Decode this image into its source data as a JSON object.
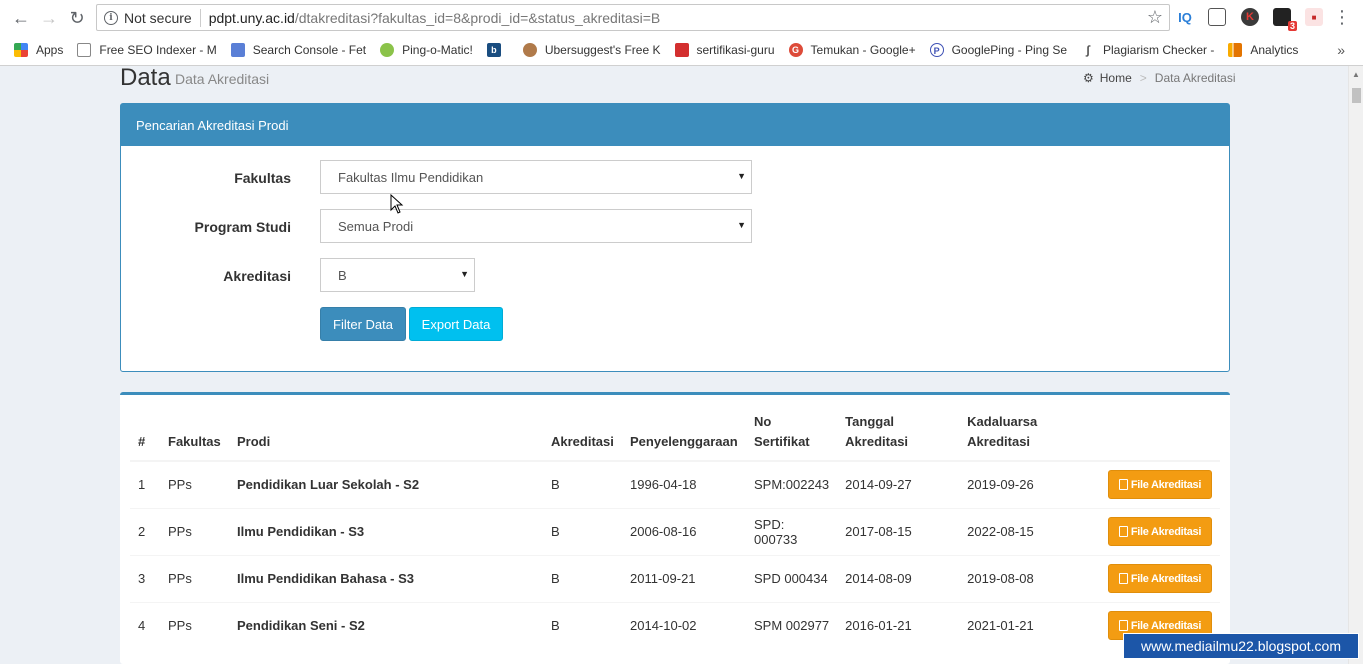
{
  "browser": {
    "security": "Not secure",
    "url_host": "pdpt.uny.ac.id",
    "url_path": "/dtakreditasi?fakultas_id=8&prodi_id=&status_akreditasi=B",
    "extensions": [
      "IQ",
      "K",
      "3"
    ],
    "bookmarks": [
      {
        "label": "Apps",
        "icon": "apps-grid-icon",
        "color": "#e53935"
      },
      {
        "label": "Free SEO Indexer - M",
        "icon": "page-icon",
        "color": "#ffffff"
      },
      {
        "label": "Search Console - Fet",
        "icon": "search-console-icon",
        "color": "#5a7fd6"
      },
      {
        "label": "Ping-o-Matic!",
        "icon": "ping-icon",
        "color": "#8bc34a"
      },
      {
        "label": "",
        "icon": "bing-icon",
        "color": "#1a4d80"
      },
      {
        "label": "Ubersuggest's Free K",
        "icon": "ubersuggest-icon",
        "color": "#b07a4a"
      },
      {
        "label": "sertifikasi-guru",
        "icon": "bookmark-red-icon",
        "color": "#d32f2f"
      },
      {
        "label": "Temukan - Google+",
        "icon": "google-plus-icon",
        "color": "#dd4b39"
      },
      {
        "label": "GooglePing - Ping Se",
        "icon": "googleping-icon",
        "color": "#3f51b5"
      },
      {
        "label": "Plagiarism Checker -",
        "icon": "plagiarism-icon",
        "color": "#555555"
      },
      {
        "label": "Analytics",
        "icon": "analytics-icon",
        "color": "#f9ab00"
      }
    ]
  },
  "page": {
    "title": "Data",
    "subtitle": "Data Akreditasi",
    "breadcrumb_home": "Home",
    "breadcrumb_current": "Data Akreditasi"
  },
  "search_box": {
    "header": "Pencarian Akreditasi Prodi",
    "fakultas_label": "Fakultas",
    "fakultas_value": "Fakultas Ilmu Pendidikan",
    "prodi_label": "Program Studi",
    "prodi_value": "Semua Prodi",
    "akreditasi_label": "Akreditasi",
    "akreditasi_value": "B",
    "filter_button": "Filter Data",
    "export_button": "Export Data"
  },
  "table": {
    "headers": [
      "#",
      "Fakultas",
      "Prodi",
      "Akreditasi",
      "Penyelenggaraan",
      "No Sertifikat",
      "Tanggal Akreditasi",
      "Kadaluarsa Akreditasi",
      ""
    ],
    "file_button_label": "File Akreditasi",
    "rows": [
      {
        "no": "1",
        "fakultas": "PPs",
        "prodi": "Pendidikan Luar Sekolah - S2",
        "akreditasi": "B",
        "penyelenggaraan": "1996-04-18",
        "sertifikat": "SPM:002243",
        "tanggal": "2014-09-27",
        "kadaluarsa": "2019-09-26"
      },
      {
        "no": "2",
        "fakultas": "PPs",
        "prodi": "Ilmu Pendidikan - S3",
        "akreditasi": "B",
        "penyelenggaraan": "2006-08-16",
        "sertifikat": "SPD: 000733",
        "tanggal": "2017-08-15",
        "kadaluarsa": "2022-08-15"
      },
      {
        "no": "3",
        "fakultas": "PPs",
        "prodi": "Ilmu Pendidikan Bahasa - S3",
        "akreditasi": "B",
        "penyelenggaraan": "2011-09-21",
        "sertifikat": "SPD 000434",
        "tanggal": "2014-08-09",
        "kadaluarsa": "2019-08-08"
      },
      {
        "no": "4",
        "fakultas": "PPs",
        "prodi": "Pendidikan Seni - S2",
        "akreditasi": "B",
        "penyelenggaraan": "2014-10-02",
        "sertifikat": "SPM 002977",
        "tanggal": "2016-01-21",
        "kadaluarsa": "2021-01-21"
      }
    ]
  },
  "watermark": "www.mediailmu22.blogspot.com"
}
